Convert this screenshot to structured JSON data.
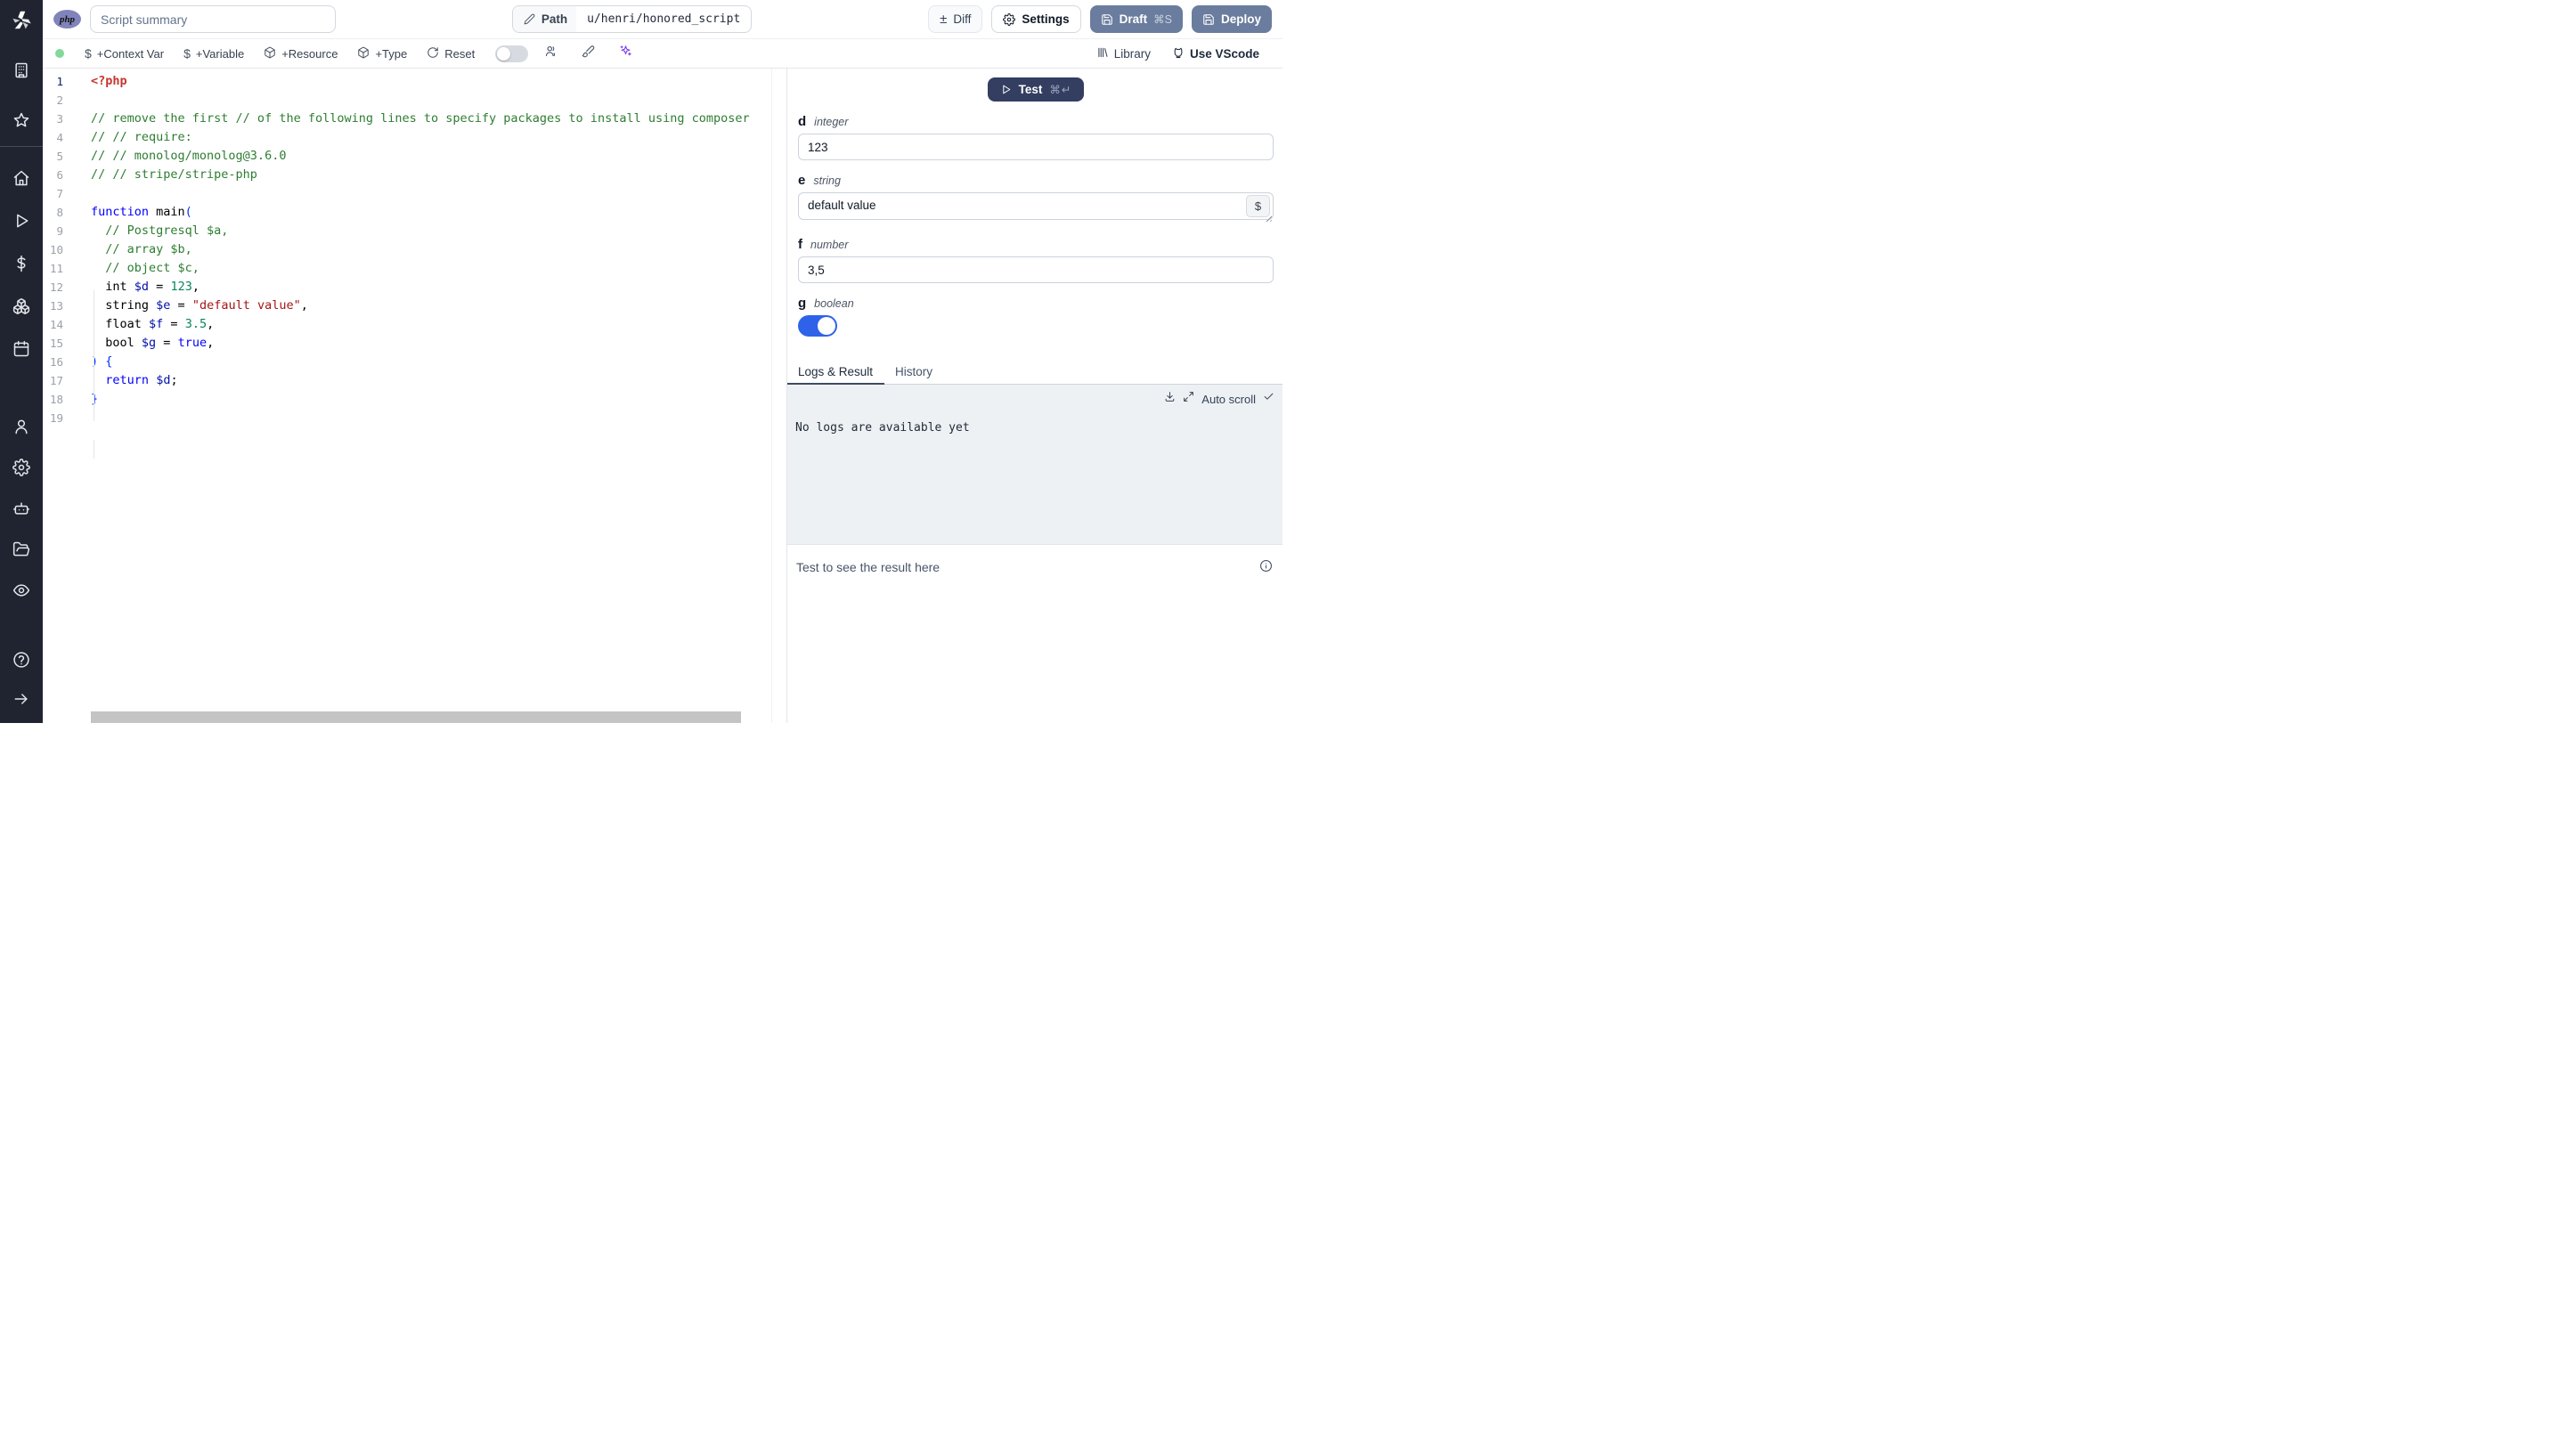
{
  "header": {
    "language_badge": "php",
    "summary_placeholder": "Script summary",
    "path_label": "Path",
    "path_value": "u/henri/honored_script",
    "diff_label": "Diff",
    "settings_label": "Settings",
    "draft_label": "Draft",
    "draft_shortcut": "⌘S",
    "deploy_label": "Deploy"
  },
  "toolbar": {
    "status_dot": "connected",
    "add_context_var": "+Context Var",
    "add_variable": "+Variable",
    "add_resource": "+Resource",
    "add_type": "+Type",
    "reset_label": "Reset",
    "library_label": "Library",
    "use_vscode_label": "Use VScode"
  },
  "sidebar": {
    "top": [
      "building",
      "star"
    ],
    "main": [
      "home",
      "play",
      "dollar",
      "boxes",
      "calendar"
    ],
    "account": [
      "user",
      "gear",
      "bot",
      "folder",
      "eye"
    ],
    "bottom": [
      "help",
      "arrow-right"
    ]
  },
  "editor": {
    "language": "php",
    "active_line": 1,
    "lines": [
      {
        "num": 1,
        "segs": [
          {
            "t": "<?php",
            "c": "metatag"
          }
        ]
      },
      {
        "num": 2,
        "segs": []
      },
      {
        "num": 3,
        "segs": [
          {
            "t": "// remove the first // of the following lines to specify packages to install using composer",
            "c": "comment"
          }
        ]
      },
      {
        "num": 4,
        "segs": [
          {
            "t": "// // require:",
            "c": "comment"
          }
        ]
      },
      {
        "num": 5,
        "segs": [
          {
            "t": "// // monolog/monolog@3.6.0",
            "c": "comment"
          }
        ]
      },
      {
        "num": 6,
        "segs": [
          {
            "t": "// // stripe/stripe-php",
            "c": "comment"
          }
        ]
      },
      {
        "num": 7,
        "segs": []
      },
      {
        "num": 8,
        "segs": [
          {
            "t": "function",
            "c": "keyword"
          },
          {
            "t": " main",
            "c": "plain"
          },
          {
            "t": "(",
            "c": "bracket"
          }
        ]
      },
      {
        "num": 9,
        "segs": [
          {
            "t": "  // Postgresql $a,",
            "c": "comment"
          }
        ]
      },
      {
        "num": 10,
        "segs": [
          {
            "t": "  // array $b,",
            "c": "comment"
          }
        ]
      },
      {
        "num": 11,
        "segs": [
          {
            "t": "  // object $c,",
            "c": "comment"
          }
        ]
      },
      {
        "num": 12,
        "segs": [
          {
            "t": "  int ",
            "c": "plain"
          },
          {
            "t": "$d",
            "c": "variable"
          },
          {
            "t": " = ",
            "c": "plain"
          },
          {
            "t": "123",
            "c": "number"
          },
          {
            "t": ",",
            "c": "plain"
          }
        ]
      },
      {
        "num": 13,
        "segs": [
          {
            "t": "  string ",
            "c": "plain"
          },
          {
            "t": "$e",
            "c": "variable"
          },
          {
            "t": " = ",
            "c": "plain"
          },
          {
            "t": "\"default value\"",
            "c": "string"
          },
          {
            "t": ",",
            "c": "plain"
          }
        ]
      },
      {
        "num": 14,
        "segs": [
          {
            "t": "  float ",
            "c": "plain"
          },
          {
            "t": "$f",
            "c": "variable"
          },
          {
            "t": " = ",
            "c": "plain"
          },
          {
            "t": "3.5",
            "c": "number"
          },
          {
            "t": ",",
            "c": "plain"
          }
        ]
      },
      {
        "num": 15,
        "segs": [
          {
            "t": "  bool ",
            "c": "plain"
          },
          {
            "t": "$g",
            "c": "variable"
          },
          {
            "t": " = ",
            "c": "plain"
          },
          {
            "t": "true",
            "c": "keyword"
          },
          {
            "t": ",",
            "c": "plain"
          }
        ]
      },
      {
        "num": 16,
        "segs": [
          {
            "t": ") {",
            "c": "bracket"
          }
        ]
      },
      {
        "num": 17,
        "segs": [
          {
            "t": "  ",
            "c": "plain"
          },
          {
            "t": "return",
            "c": "keyword"
          },
          {
            "t": " ",
            "c": "plain"
          },
          {
            "t": "$d",
            "c": "variable"
          },
          {
            "t": ";",
            "c": "plain"
          }
        ]
      },
      {
        "num": 18,
        "segs": [
          {
            "t": "}",
            "c": "bracket"
          }
        ]
      },
      {
        "num": 19,
        "segs": []
      }
    ]
  },
  "panel": {
    "test_label": "Test",
    "test_shortcut": "⌘↵",
    "fields": [
      {
        "name": "d",
        "type": "integer",
        "control": "input",
        "value": "123"
      },
      {
        "name": "e",
        "type": "string",
        "control": "textarea",
        "value": "default value",
        "button": "$"
      },
      {
        "name": "f",
        "type": "number",
        "control": "input",
        "value": "3,5"
      },
      {
        "name": "g",
        "type": "boolean",
        "control": "toggle",
        "value": true
      }
    ],
    "tabs": [
      "Logs & Result",
      "History"
    ],
    "active_tab": "Logs & Result",
    "autoscroll_label": "Auto scroll",
    "logs_empty": "No logs are available yet",
    "result_placeholder": "Test to see the result here"
  },
  "colors": {
    "sidebar-bg": "#1f2430",
    "slate": "#6b7d9e",
    "testbtn": "#333e61",
    "toggle": "#2e62e9",
    "green": "#83d89c",
    "purple": "#7c3aed",
    "php": "#8084bb",
    "c-comment": "#2e7d32",
    "c-keyword": "#0000ff",
    "c-variable": "#0010a8",
    "c-number": "#098658",
    "c-string": "#a31515",
    "c-metatag": "#c4362f",
    "c-bracket": "#0431fa"
  }
}
